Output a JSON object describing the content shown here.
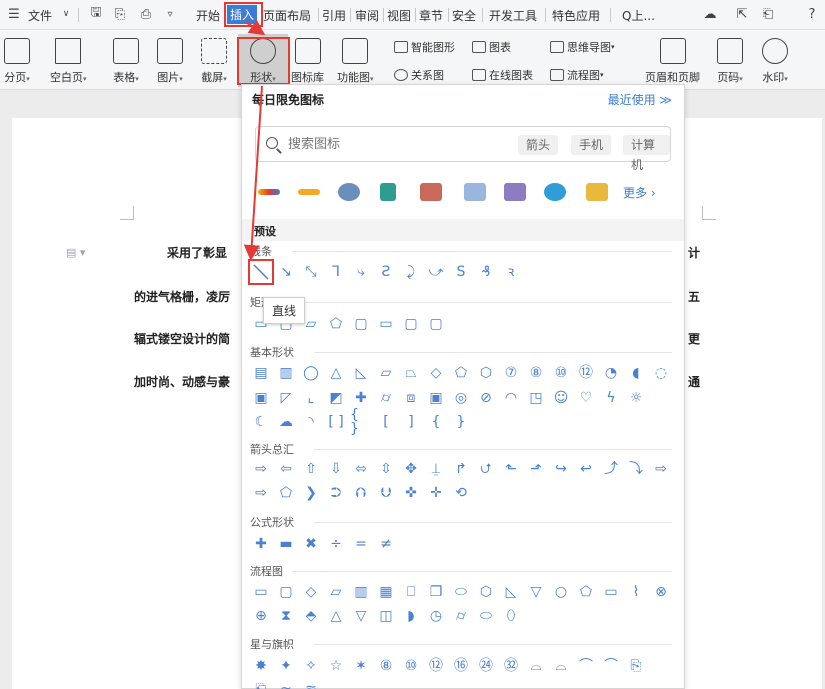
{
  "menubar": {
    "menu_icon": "hamburger-icon",
    "file_label": "文件",
    "tabs": [
      "开始",
      "插入",
      "页面布局",
      "引用",
      "审阅",
      "视图",
      "章节",
      "安全",
      "开发工具",
      "特色应用"
    ],
    "search_label": "Q上..."
  },
  "ribbon": {
    "items": [
      {
        "label": "分页",
        "icon": "page-break-icon"
      },
      {
        "label": "空白页",
        "icon": "blank-page-icon"
      },
      {
        "label": "表格",
        "icon": "table-icon"
      },
      {
        "label": "图片",
        "icon": "image-icon"
      },
      {
        "label": "截屏",
        "icon": "screenshot-icon"
      },
      {
        "label": "形状",
        "icon": "shape-icon"
      },
      {
        "label": "图标库",
        "icon": "icon-library-icon"
      },
      {
        "label": "功能图",
        "icon": "function-chart-icon"
      }
    ],
    "small_items": [
      {
        "label": "智能图形",
        "icon": "smart-graphic-icon"
      },
      {
        "label": "关系图",
        "icon": "relation-chart-icon"
      },
      {
        "label": "图表",
        "icon": "chart-icon"
      },
      {
        "label": "在线图表",
        "icon": "online-chart-icon"
      },
      {
        "label": "思维导图",
        "icon": "mindmap-icon"
      },
      {
        "label": "流程图",
        "icon": "flowchart-icon"
      }
    ],
    "right_items": [
      {
        "label": "页眉和页脚",
        "icon": "header-footer-icon"
      },
      {
        "label": "页码",
        "icon": "page-number-icon"
      },
      {
        "label": "水印",
        "icon": "watermark-icon"
      }
    ]
  },
  "document": {
    "lines": [
      {
        "left": "采用了彰显",
        "right": "计"
      },
      {
        "left": "的进气格栅，凌厉",
        "right": "五"
      },
      {
        "left": "辐式镂空设计的简",
        "right": "更"
      },
      {
        "left": "加时尚、动感与豪",
        "right": "通"
      }
    ]
  },
  "panel": {
    "title": "每日限免图标",
    "recent": "最近使用 ≫",
    "search_placeholder": "搜索图标",
    "chips": [
      "箭头",
      "手机",
      "计算机"
    ],
    "more": "更多 ›",
    "preset": "预设",
    "categories": {
      "lines": "线条",
      "rect": "矩形",
      "basic": "基本形状",
      "arrows": "箭头总汇",
      "formula": "公式形状",
      "flowchart": "流程图",
      "stars": "星与旗帜"
    },
    "tooltip": "直线"
  },
  "colors": {
    "accent": "#3b7cd6",
    "highlight": "#e53935",
    "shape_stroke": "#4a82d2"
  }
}
